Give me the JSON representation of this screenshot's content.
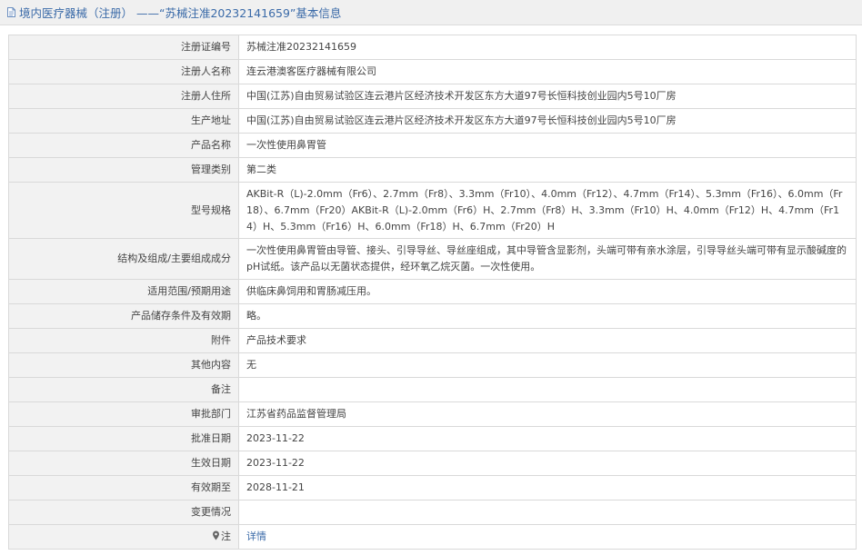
{
  "header": {
    "icon": "document-icon",
    "title": "境内医疗器械（注册） ——“苏械注准20232141659”基本信息"
  },
  "rows": [
    {
      "label": "注册证编号",
      "value": "苏械注准20232141659"
    },
    {
      "label": "注册人名称",
      "value": "连云港澳客医疗器械有限公司"
    },
    {
      "label": "注册人住所",
      "value": "中国(江苏)自由贸易试验区连云港片区经济技术开发区东方大道97号长恒科技创业园内5号10厂房"
    },
    {
      "label": "生产地址",
      "value": "中国(江苏)自由贸易试验区连云港片区经济技术开发区东方大道97号长恒科技创业园内5号10厂房"
    },
    {
      "label": "产品名称",
      "value": "一次性使用鼻胃管"
    },
    {
      "label": "管理类别",
      "value": "第二类"
    },
    {
      "label": "型号规格",
      "value": "AKBit-R（L)-2.0mm（Fr6）、2.7mm（Fr8）、3.3mm（Fr10）、4.0mm（Fr12）、4.7mm（Fr14）、5.3mm（Fr16）、6.0mm（Fr18）、6.7mm（Fr20）AKBit-R（L)-2.0mm（Fr6）H、2.7mm（Fr8）H、3.3mm（Fr10）H、4.0mm（Fr12）H、4.7mm（Fr14）H、5.3mm（Fr16）H、6.0mm（Fr18）H、6.7mm（Fr20）H"
    },
    {
      "label": "结构及组成/主要组成成分",
      "value": "一次性使用鼻胃管由导管、接头、引导导丝、导丝座组成，其中导管含显影剂，头端可带有亲水涂层，引导导丝头端可带有显示酸碱度的pH试纸。该产品以无菌状态提供，经环氧乙烷灭菌。一次性使用。"
    },
    {
      "label": "适用范围/预期用途",
      "value": "供临床鼻饲用和胃肠减压用。"
    },
    {
      "label": "产品储存条件及有效期",
      "value": "略。"
    },
    {
      "label": "附件",
      "value": "产品技术要求"
    },
    {
      "label": "其他内容",
      "value": "无"
    },
    {
      "label": "备注",
      "value": ""
    },
    {
      "label": "审批部门",
      "value": "江苏省药品监督管理局"
    },
    {
      "label": "批准日期",
      "value": "2023-11-22"
    },
    {
      "label": "生效日期",
      "value": "2023-11-22"
    },
    {
      "label": "有效期至",
      "value": "2028-11-21"
    },
    {
      "label": "变更情况",
      "value": ""
    }
  ],
  "note_row": {
    "icon": "pin-icon",
    "label": "注",
    "link": "详情"
  },
  "colors": {
    "accent": "#3a6aa8",
    "label_bg": "#f2f2f2",
    "border": "#d9d9d9"
  }
}
